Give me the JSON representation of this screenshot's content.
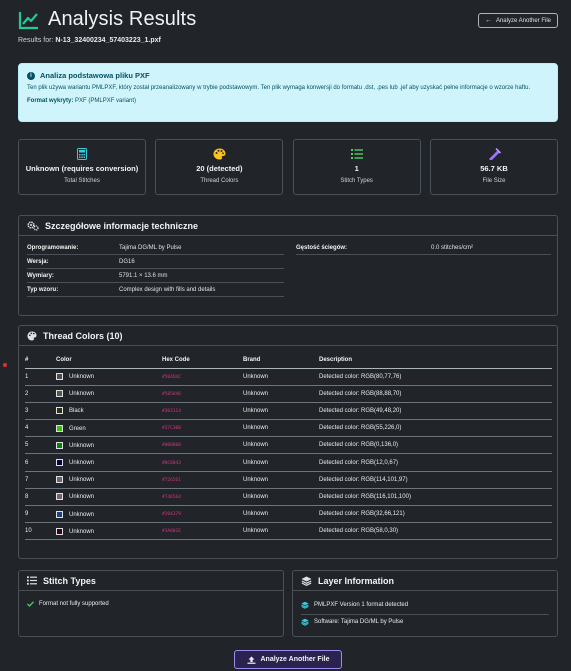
{
  "header": {
    "title": "Analysis Results",
    "results_for_label": "Results for:",
    "filename": "N-13_32400234_57403223_1.pxf",
    "back_button": "Analyze Another File"
  },
  "alert": {
    "title": "Analiza podstawowa pliku PXF",
    "text": "Ten plik używa wariantu PMLPXF, który został przeanalizowany w trybie podstawowym. Ten plik wymaga konwersji do formatu .dst, .pes lub .jef aby uzyskać pełne informacje o wzorze haftu.",
    "format_label": "Format wykryty:",
    "format_value": "PXF (PMLPXF variant)"
  },
  "stats": [
    {
      "value": "Unknown (requires conversion)",
      "label": "Total Stitches",
      "icon": "calculator-icon"
    },
    {
      "value": "20 (detected)",
      "label": "Thread Colors",
      "icon": "palette-icon"
    },
    {
      "value": "1",
      "label": "Stitch Types",
      "icon": "list-icon"
    },
    {
      "value": "56.7 KB",
      "label": "File Size",
      "icon": "weight-icon"
    }
  ],
  "tech": {
    "title": "Szczegółowe informacje techniczne",
    "left": [
      {
        "k": "Oprogramowanie:",
        "v": "Tajima DG/ML by Pulse"
      },
      {
        "k": "Wersja:",
        "v": "DG16"
      },
      {
        "k": "Wymiary:",
        "v": "5791.1 × 13.6 mm"
      },
      {
        "k": "Typ wzoru:",
        "v": "Complex design with fills and details"
      }
    ],
    "right": [
      {
        "k": "Gęstość ściegów:",
        "v": "0.0 stitches/cm²"
      }
    ]
  },
  "threads": {
    "title": "Thread Colors (10)",
    "columns": [
      "#",
      "Color",
      "Hex Code",
      "Brand",
      "Description"
    ],
    "rows": [
      {
        "n": "1",
        "name": "Unknown",
        "hex": "#504D4C",
        "swatch": "#504d4c",
        "brand": "Unknown",
        "desc": "Detected color: RGB(80,77,76)"
      },
      {
        "n": "2",
        "name": "Unknown",
        "hex": "#585846",
        "swatch": "#585846",
        "brand": "Unknown",
        "desc": "Detected color: RGB(88,88,70)"
      },
      {
        "n": "3",
        "name": "Black",
        "hex": "#303114",
        "swatch": "#303114",
        "brand": "Unknown",
        "desc": "Detected color: RGB(49,48,20)"
      },
      {
        "n": "4",
        "name": "Green",
        "hex": "#37C300",
        "swatch": "#37c300",
        "brand": "Unknown",
        "desc": "Detected color: RGB(55,226,0)"
      },
      {
        "n": "5",
        "name": "Unknown",
        "hex": "#008800",
        "swatch": "#008800",
        "brand": "Unknown",
        "desc": "Detected color: RGB(0,136,0)"
      },
      {
        "n": "6",
        "name": "Unknown",
        "hex": "#0C0043",
        "swatch": "#0c0043",
        "brand": "Unknown",
        "desc": "Detected color: RGB(12,0,67)"
      },
      {
        "n": "7",
        "name": "Unknown",
        "hex": "#726561",
        "swatch": "#726561",
        "brand": "Unknown",
        "desc": "Detected color: RGB(114,101,97)"
      },
      {
        "n": "8",
        "name": "Unknown",
        "hex": "#746564",
        "swatch": "#746564",
        "brand": "Unknown",
        "desc": "Detected color: RGB(116,101,100)"
      },
      {
        "n": "9",
        "name": "Unknown",
        "hex": "#204379",
        "swatch": "#204379",
        "brand": "Unknown",
        "desc": "Detected color: RGB(32,66,121)"
      },
      {
        "n": "10",
        "name": "Unknown",
        "hex": "#3A001E",
        "swatch": "#3a001e",
        "brand": "Unknown",
        "desc": "Detected color: RGB(58,0,30)"
      }
    ]
  },
  "stitch_types": {
    "title": "Stitch Types",
    "items": [
      "Format not fully supported"
    ]
  },
  "layers": {
    "title": "Layer Information",
    "items": [
      "PMLPXF Version 1 format detected",
      "Software: Tajima DG/ML by Pulse"
    ]
  },
  "bottom_button": "Analyze Another File",
  "colors": {
    "accent": "#20c997",
    "alert_bg": "#cff4fc",
    "hex_text": "#d63384",
    "button_border": "#9d8cf0"
  }
}
